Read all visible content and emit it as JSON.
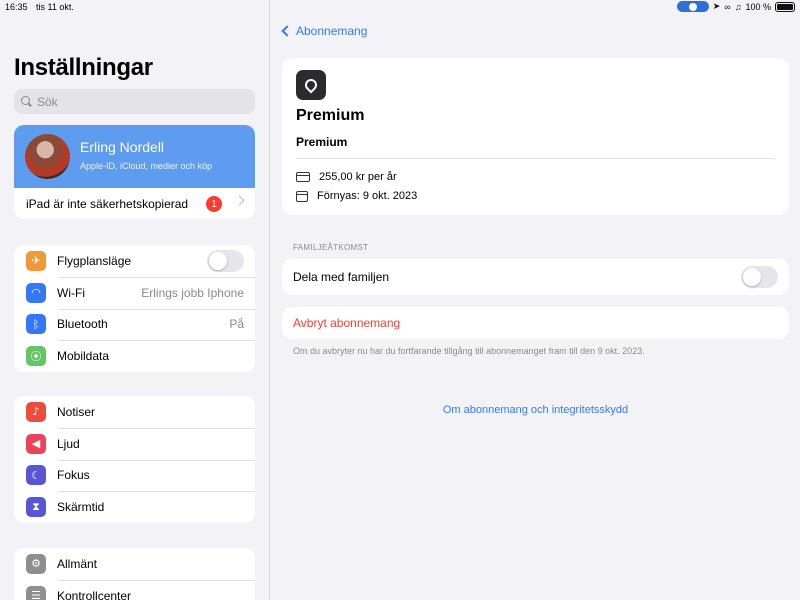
{
  "status_bar": {
    "time": "16:35",
    "date": "tis 11 okt.",
    "battery": "100 %"
  },
  "sidebar": {
    "title": "Inställningar",
    "search_placeholder": "Sök",
    "profile": {
      "name": "Erling Nordell",
      "subtitle": "Apple-ID, iCloud, medier och köp"
    },
    "backup": {
      "label": "iPad är inte säkerhetskopierad",
      "badge": "1"
    },
    "group1": [
      {
        "label": "Flygplansläge",
        "icon": "airplane-icon",
        "color": "#f09a37",
        "toggle": false
      },
      {
        "label": "Wi-Fi",
        "icon": "wifi-icon",
        "color": "#3478f6",
        "value": "Erlings jobb Iphone"
      },
      {
        "label": "Bluetooth",
        "icon": "bluetooth-icon",
        "color": "#3478f6",
        "value": "På"
      },
      {
        "label": "Mobildata",
        "icon": "antenna-icon",
        "color": "#65c466"
      }
    ],
    "group2": [
      {
        "label": "Notiser",
        "icon": "bell-icon",
        "color": "#eb4d3d"
      },
      {
        "label": "Ljud",
        "icon": "speaker-icon",
        "color": "#eb445a"
      },
      {
        "label": "Fokus",
        "icon": "moon-icon",
        "color": "#5856d6"
      },
      {
        "label": "Skärmtid",
        "icon": "hourglass-icon",
        "color": "#5856d6"
      }
    ],
    "group3": [
      {
        "label": "Allmänt",
        "icon": "gear-icon",
        "color": "#8e8e93"
      },
      {
        "label": "Kontrollcenter",
        "icon": "switches-icon",
        "color": "#8e8e93"
      }
    ]
  },
  "main": {
    "back_label": "Abonnemang",
    "subscription": {
      "title": "Premium",
      "subtitle": "Premium",
      "price": "255,00 kr per år",
      "renewal": "Förnyas: 9 okt. 2023"
    },
    "family_section": "FAMILJEÅTKOMST",
    "family_label": "Dela med familjen",
    "family_toggle": false,
    "cancel_label": "Avbryt abonnemang",
    "cancel_note": "Om du avbryter nu har du fortfarande tillgång till abonnemanget fram till den 9 okt. 2023.",
    "privacy_link": "Om abonnemang och integritetsskydd"
  }
}
